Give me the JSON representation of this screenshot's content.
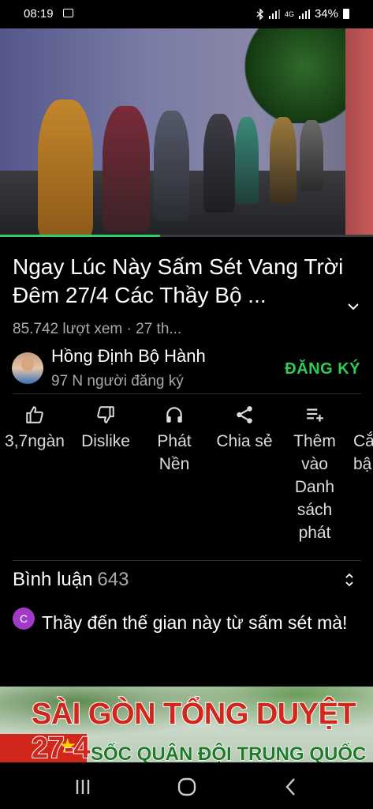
{
  "status_bar": {
    "time": "08:19",
    "network": "4G",
    "battery": "34%"
  },
  "video": {
    "progress_fraction": 0.43
  },
  "title": "Ngay Lúc Này Sấm Sét Vang Trời Đêm 27/4 Các Thầy Bộ ...",
  "meta": "85.742 lượt xem · 27 th...",
  "channel": {
    "name": "Hồng Định Bộ Hành",
    "subscribers": "97 N người đăng ký",
    "subscribe_label": "ĐĂNG KÝ",
    "accent": "#2ecc52"
  },
  "actions": {
    "like": "3,7ngàn",
    "dislike": "Dislike",
    "background_1": "Phát",
    "background_2": "Nền",
    "share": "Chia sẻ",
    "save_1": "Thêm",
    "save_2": "vào",
    "save_3": "Danh",
    "save_4": "sách",
    "save_5": "phát",
    "clip_1": "Cắ",
    "clip_2": "bậ"
  },
  "comments": {
    "label": "Bình luận",
    "count": "643",
    "first_avatar_letter": "C",
    "first_avatar_color": "#a23ac8",
    "first_text": "Thầy đến thế gian này từ sấm sét mà!"
  },
  "ad": {
    "headline": "SÀI GÒN TỔNG DUYỆT 27-4",
    "subline": "SỐC QUÂN ĐỘI TRUNG QUỐC"
  },
  "icons": {
    "like": "thumb-up-icon",
    "dislike": "thumb-down-icon",
    "background": "headphones-icon",
    "share": "share-icon",
    "save": "playlist-add-icon",
    "sort": "sort-icon"
  }
}
